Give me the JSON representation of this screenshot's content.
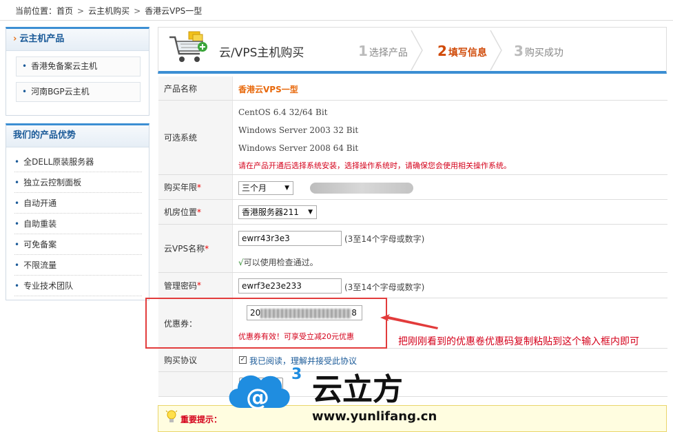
{
  "breadcrumb": {
    "prefix": "当前位置：",
    "items": [
      "首页",
      "云主机购买",
      "香港云VPS一型"
    ],
    "sep": ">"
  },
  "sidebar": {
    "products_title": "云主机产品",
    "products": [
      "香港免备案云主机",
      "河南BGP云主机"
    ],
    "advantages_title": "我们的产品优势",
    "advantages": [
      "全DELL原装服务器",
      "独立云控制面板",
      "自动开通",
      "自助重装",
      "可免备案",
      "不限流量",
      "专业技术团队"
    ]
  },
  "header": {
    "title": "云/VPS主机购买",
    "steps": [
      {
        "num": "1",
        "label": "选择产品"
      },
      {
        "num": "2",
        "label": "填写信息"
      },
      {
        "num": "3",
        "label": "购买成功"
      }
    ]
  },
  "form": {
    "product_name": {
      "label": "产品名称",
      "value": "香港云VPS一型"
    },
    "os": {
      "label": "可选系统",
      "options": [
        "CentOS 6.4 32/64 Bit",
        "Windows Server 2003 32 Bit",
        "Windows Server 2008 64 Bit"
      ],
      "note": "请在产品开通后选择系统安装，选择操作系统时，请确保您会使用相关操作系统。"
    },
    "period": {
      "label": "购买年限",
      "required": "*",
      "value": "三个月"
    },
    "location": {
      "label": "机房位置",
      "required": "*",
      "value": "香港服务器211"
    },
    "vps_name": {
      "label": "云VPS名称",
      "required": "*",
      "value": "ewrr43r3e3",
      "hint": "(3至14个字母或数字)",
      "check_mark": "√",
      "check": "可以使用检查通过。"
    },
    "password": {
      "label": "管理密码",
      "required": "*",
      "value": "ewrf3e23e233",
      "hint": "(3至14个字母或数字)"
    },
    "coupon": {
      "label": "优惠券：",
      "value": "20",
      "value_tail": "8",
      "note": "优惠券有效！可享受立减20元优惠"
    },
    "agreement": {
      "label": "购买协议",
      "text": "我已阅读，理解并接受此协议"
    },
    "submit": "立即购买"
  },
  "annotation": {
    "text": "把刚刚看到的优惠卷优惠码复制粘贴到这个输入框内即可"
  },
  "tip": {
    "text": "重要提示："
  },
  "watermark": {
    "brand": "云立方",
    "url": "www.yunlifang.cn",
    "superscript": "3"
  },
  "colors": {
    "accent_blue": "#3b8ed3",
    "active_step": "#d04a08",
    "warning_red": "#d4001a",
    "product_orange": "#e8680a"
  }
}
